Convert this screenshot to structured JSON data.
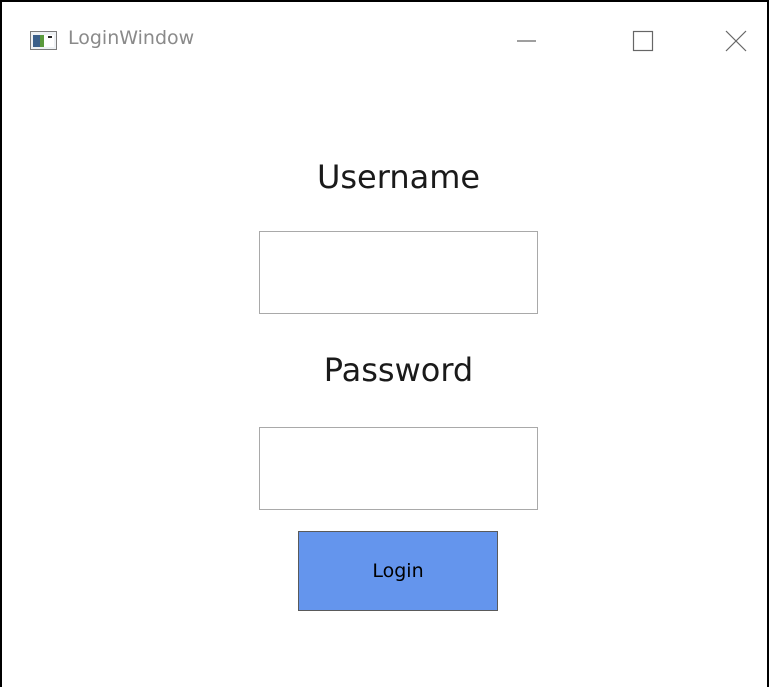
{
  "window": {
    "title": "LoginWindow",
    "icon": "window-app-icon",
    "controls": {
      "minimize_icon": "minimize-icon",
      "maximize_icon": "maximize-icon",
      "close_icon": "close-icon"
    }
  },
  "form": {
    "username_label": "Username",
    "username_value": "",
    "password_label": "Password",
    "password_value": "",
    "login_label": "Login"
  },
  "colors": {
    "login_button_bg": "#6495ed",
    "window_border": "#000000",
    "title_text": "#8a8a8a",
    "field_border": "#a9a9a9"
  }
}
